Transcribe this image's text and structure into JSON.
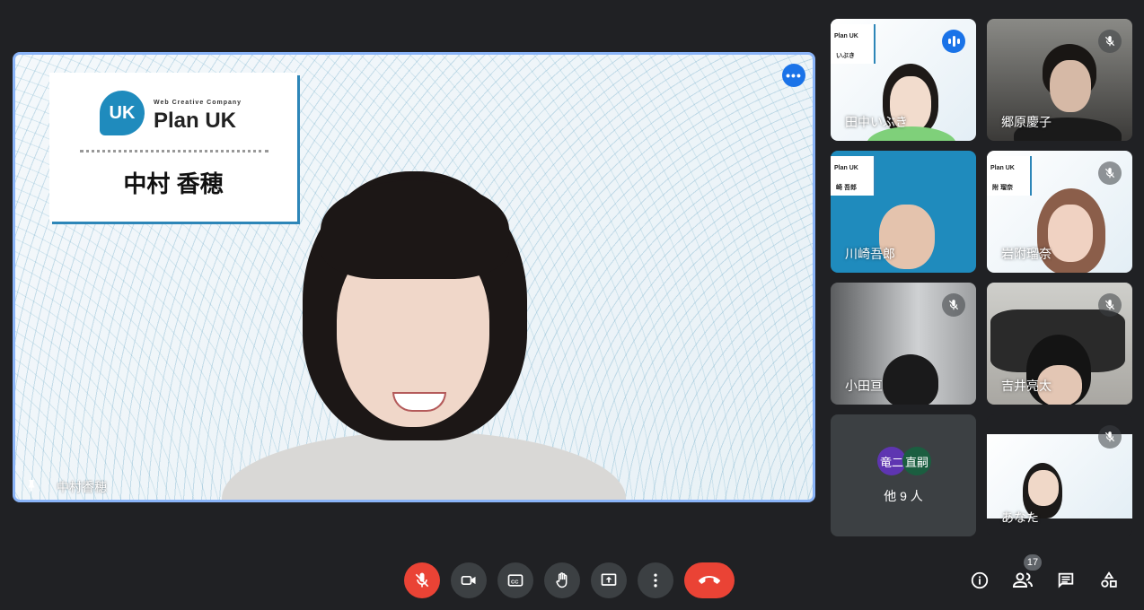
{
  "main_speaker": {
    "name": "中村香穂",
    "card_company_tag": "Web Creative Company",
    "card_logo_text": "Plan UK",
    "card_logo_mark": "UK",
    "card_person": "中村 香穂"
  },
  "tiles": [
    {
      "name": "田中いぶき",
      "mini_logo": "Plan UK",
      "mini_name": "いぶき"
    },
    {
      "name": "郷原慶子"
    },
    {
      "name": "川崎吾郎",
      "mini_logo": "Plan UK",
      "mini_name": "崎 吾郎"
    },
    {
      "name": "岩附瑠奈",
      "mini_logo": "Plan UK",
      "mini_name": "附 瑠奈"
    },
    {
      "name": "小田亘"
    },
    {
      "name": "吉井亮太"
    },
    {
      "name": "あなた"
    }
  ],
  "others": {
    "avatars": [
      "竜二",
      "直嗣"
    ],
    "label": "他 9 人"
  },
  "participant_count": "17",
  "colors": {
    "background": "#202124",
    "control_bg": "#3c4043",
    "danger": "#ea4335",
    "accent": "#1a73e8",
    "speaker_border": "#8ab4f8"
  }
}
